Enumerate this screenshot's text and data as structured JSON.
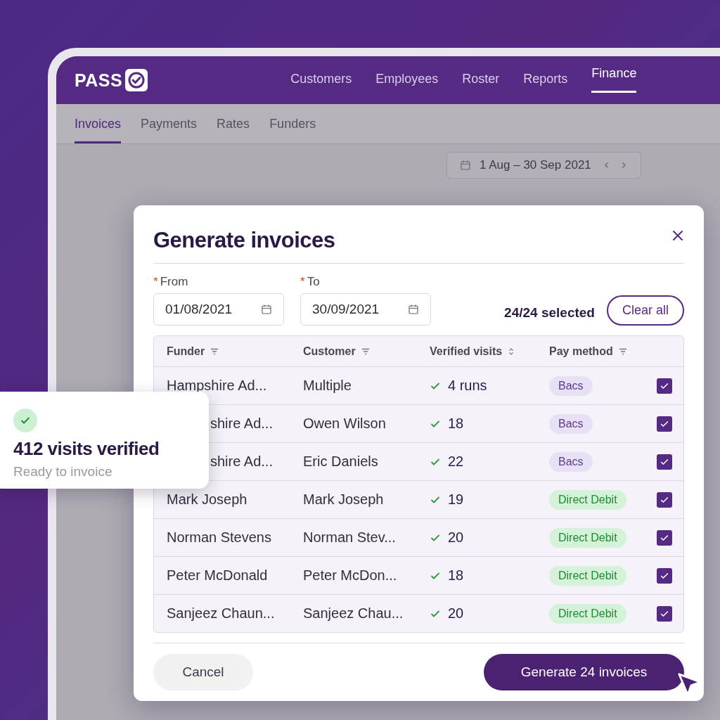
{
  "app": {
    "logo": "PASS",
    "nav": [
      {
        "label": "Customers",
        "selected": false
      },
      {
        "label": "Employees",
        "selected": false
      },
      {
        "label": "Roster",
        "selected": false
      },
      {
        "label": "Reports",
        "selected": false
      },
      {
        "label": "Finance",
        "selected": true
      }
    ],
    "subnav": [
      {
        "label": "Invoices",
        "selected": true
      },
      {
        "label": "Payments",
        "selected": false
      },
      {
        "label": "Rates",
        "selected": false
      },
      {
        "label": "Funders",
        "selected": false
      }
    ],
    "date_range": "1 Aug – 30 Sep 2021"
  },
  "dialog": {
    "title": "Generate invoices",
    "fields": [
      {
        "required_mark": "*",
        "label": "From",
        "value": "01/08/2021"
      },
      {
        "required_mark": "*",
        "label": "To",
        "value": "30/09/2021"
      }
    ],
    "selection": "24/24 selected",
    "clear_button": "Clear all",
    "table": {
      "columns": [
        {
          "label": "Funder",
          "kind": "filter"
        },
        {
          "label": "Customer",
          "kind": "filter"
        },
        {
          "label": "Verified visits",
          "kind": "sort"
        },
        {
          "label": "Pay method",
          "kind": "filter"
        }
      ],
      "rows": [
        {
          "funder": "Hampshire Ad...",
          "covered": false,
          "customer": "Multiple",
          "visits": "4 runs",
          "pay_method": {
            "label": "Bacs",
            "kind": "bacs"
          },
          "checked": true
        },
        {
          "funder": "shire Ad...",
          "covered": true,
          "customer": "Owen Wilson",
          "visits": "18",
          "pay_method": {
            "label": "Bacs",
            "kind": "bacs"
          },
          "checked": true
        },
        {
          "funder": "shire Ad...",
          "covered": true,
          "customer": "Eric Daniels",
          "visits": "22",
          "pay_method": {
            "label": "Bacs",
            "kind": "bacs"
          },
          "checked": true
        },
        {
          "funder": "Mark Joseph",
          "covered": false,
          "customer": "Mark Joseph",
          "visits": "19",
          "pay_method": {
            "label": "Direct Debit",
            "kind": "direct_debit"
          },
          "checked": true
        },
        {
          "funder": "Norman Stevens",
          "covered": false,
          "customer": "Norman Stev...",
          "visits": "20",
          "pay_method": {
            "label": "Direct Debit",
            "kind": "direct_debit"
          },
          "checked": true
        },
        {
          "funder": "Peter McDonald",
          "covered": false,
          "customer": "Peter McDon...",
          "visits": "18",
          "pay_method": {
            "label": "Direct Debit",
            "kind": "direct_debit"
          },
          "checked": true
        },
        {
          "funder": "Sanjeez Chaun...",
          "covered": false,
          "customer": "Sanjeez Chau...",
          "visits": "20",
          "pay_method": {
            "label": "Direct Debit",
            "kind": "direct_debit"
          },
          "checked": true
        }
      ]
    },
    "cancel_button": "Cancel",
    "generate_button": "Generate 24 invoices"
  },
  "toast": {
    "title": "412 visits verified",
    "subtitle": "Ready to invoice"
  }
}
